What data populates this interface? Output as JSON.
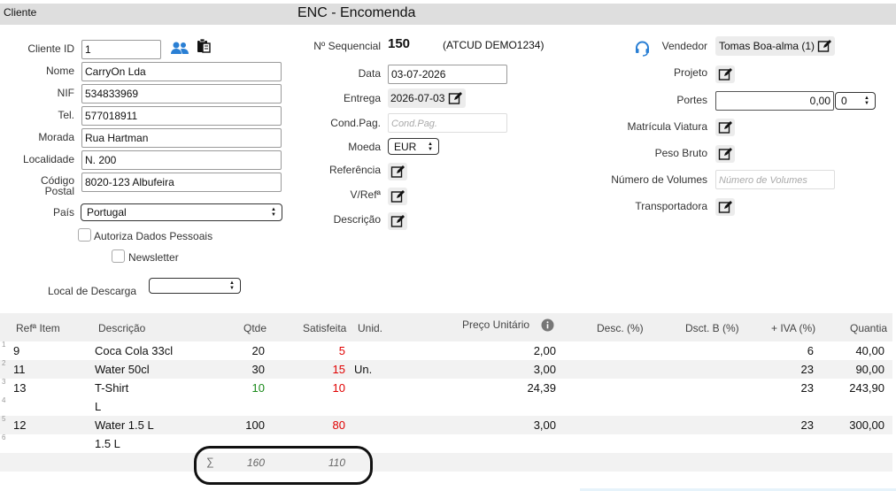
{
  "header": {
    "left_label": "Cliente",
    "title": "ENC - Encomenda"
  },
  "client": {
    "id_label": "Cliente ID",
    "id_value": "1",
    "nome_label": "Nome",
    "nome_value": "CarryOn Lda",
    "nif_label": "NIF",
    "nif_value": "534833969",
    "tel_label": "Tel.",
    "tel_value": "577018911",
    "morada_label": "Morada",
    "morada_value": "Rua Hartman",
    "localidade_label": "Localidade",
    "localidade_value": "N. 200",
    "codigo_label_1": "Código",
    "codigo_label_2": "Postal",
    "codigo_value": "8020-123 Albufeira",
    "pais_label": "País",
    "pais_value": "Portugal",
    "autoriza_label": "Autoriza Dados Pessoais",
    "newsletter_label": "Newsletter",
    "local_descarga_label": "Local de Descarga",
    "local_descarga_value": ""
  },
  "doc": {
    "seq_label": "Nº Sequencial",
    "seq_value": "150",
    "atcud": "(ATCUD DEMO1234)",
    "data_label": "Data",
    "data_value": "03-07-2026",
    "entrega_label": "Entrega",
    "entrega_value": "2026-07-03",
    "cond_label": "Cond.Pag.",
    "cond_placeholder": "Cond.Pag.",
    "moeda_label": "Moeda",
    "moeda_value": "EUR",
    "referencia_label": "Referência",
    "vref_label": "V/Refª",
    "descricao_label": "Descrição"
  },
  "right": {
    "vendedor_label": "Vendedor",
    "vendedor_value": "Tomas Boa-alma (1)",
    "projeto_label": "Projeto",
    "portes_label": "Portes",
    "portes_value": "0,00",
    "portes_select": "0",
    "matricula_label": "Matrícula Viatura",
    "peso_label": "Peso Bruto",
    "volumes_label": "Número de Volumes",
    "volumes_placeholder": "Número de Volumes",
    "transportadora_label": "Transportadora"
  },
  "table": {
    "headers": [
      "Refª Item",
      "Descrição",
      "Qtde",
      "Satisfeita",
      "Unid.",
      "Preço Unitário",
      "Desc. (%)",
      "Dsct. B (%)",
      "+ IVA (%)",
      "Quantia"
    ],
    "rows": [
      {
        "n": "1",
        "ref": "9",
        "desc": "Coca Cola 33cl",
        "qtde": "20",
        "sat": "5",
        "unid": "",
        "preco": "2,00",
        "iva": "6",
        "quantia": "40,00"
      },
      {
        "n": "2",
        "ref": "11",
        "desc": "Water 50cl",
        "qtde": "30",
        "sat": "15",
        "unid": "Un.",
        "preco": "3,00",
        "iva": "23",
        "quantia": "90,00"
      },
      {
        "n": "3",
        "ref": "13",
        "desc": "T-Shirt",
        "qtde": "10",
        "sat": "10",
        "unid": "",
        "preco": "24,39",
        "iva": "23",
        "quantia": "243,90"
      },
      {
        "n": "4",
        "ref": "",
        "desc": "L",
        "qtde": "",
        "sat": "",
        "unid": "",
        "preco": "",
        "iva": "",
        "quantia": ""
      },
      {
        "n": "5",
        "ref": "12",
        "desc": "Water 1.5 L",
        "qtde": "100",
        "sat": "80",
        "unid": "",
        "preco": "3,00",
        "iva": "23",
        "quantia": "300,00"
      },
      {
        "n": "6",
        "ref": "",
        "desc": "1.5 L",
        "qtde": "",
        "sat": "",
        "unid": "",
        "preco": "",
        "iva": "",
        "quantia": ""
      }
    ],
    "sum_symbol": "∑",
    "sum_qtde": "160",
    "sum_sat": "110"
  },
  "colors": {
    "accent_blue": "#2a7fd4",
    "red": "#e00000",
    "green": "#1a8a1a"
  },
  "icons": [
    "people-icon",
    "clipboard-icon",
    "headset-icon",
    "edit-icon",
    "info-icon",
    "sort-arrows-icon"
  ]
}
